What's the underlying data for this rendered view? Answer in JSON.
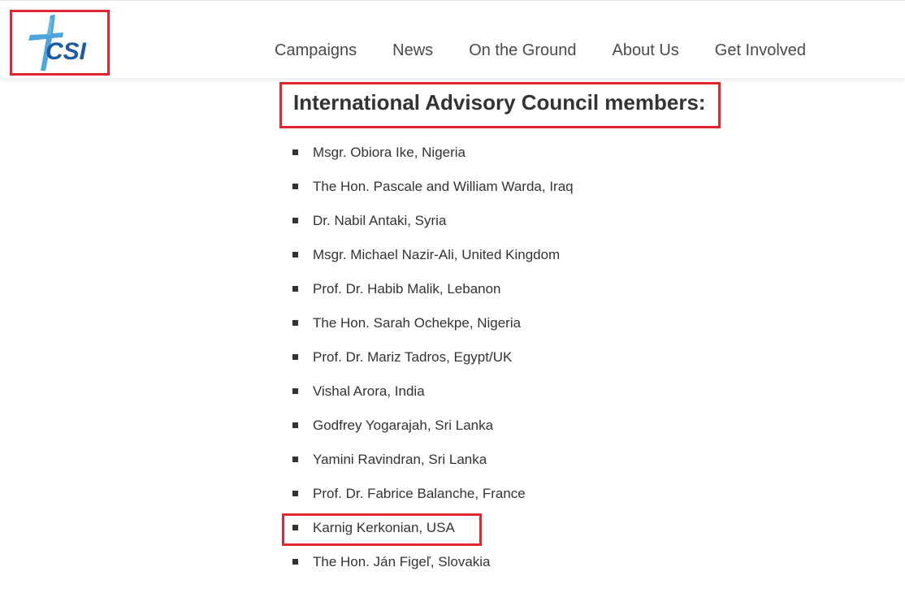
{
  "header": {
    "logo_text": "CSI",
    "nav": [
      {
        "label": "Campaigns"
      },
      {
        "label": "News"
      },
      {
        "label": "On the Ground"
      },
      {
        "label": "About Us"
      },
      {
        "label": "Get Involved"
      }
    ]
  },
  "main": {
    "heading": "International Advisory Council members:",
    "members": [
      "Msgr. Obiora Ike, Nigeria",
      "The Hon. Pascale and William Warda, Iraq",
      "Dr. Nabil Antaki, Syria",
      "Msgr. Michael Nazir-Ali, United Kingdom",
      "Prof. Dr. Habib Malik, Lebanon",
      "The Hon. Sarah Ochekpe, Nigeria",
      "Prof. Dr. Mariz Tadros, Egypt/UK",
      "Vishal Arora, India",
      "Godfrey Yogarajah, Sri Lanka",
      "Yamini Ravindran, Sri Lanka",
      "Prof. Dr. Fabrice Balanche, France",
      "Karnig Kerkonian, USA",
      "The Hon. Ján Figeľ, Slovakia"
    ]
  },
  "colors": {
    "highlight_border": "#e0262f",
    "logo_cross": "#3a9bd8",
    "logo_text": "#1c5aa6",
    "text": "#333333"
  }
}
